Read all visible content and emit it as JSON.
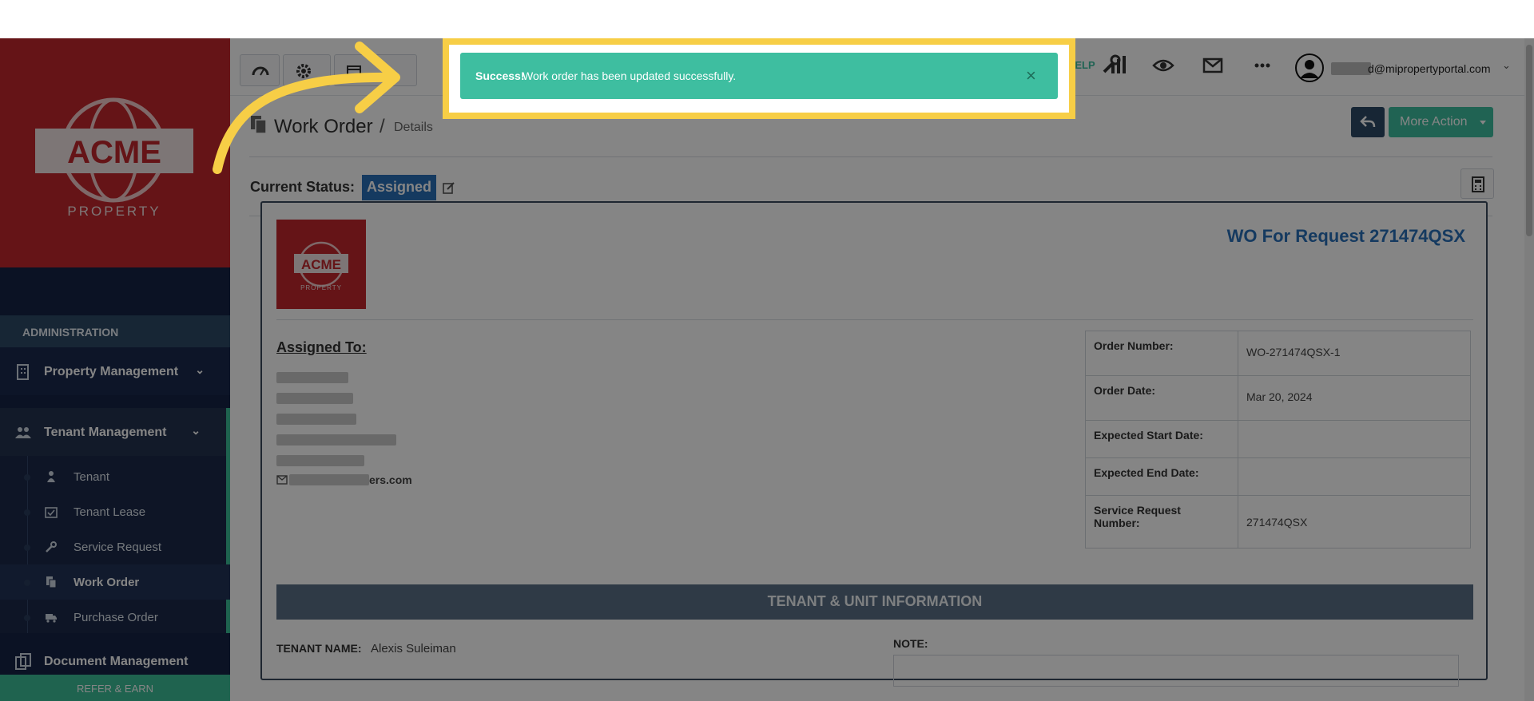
{
  "sidebar": {
    "logo_text": "ACME",
    "logo_sub": "PROPERTY",
    "section_header": "ADMINISTRATION",
    "nav": [
      {
        "label": "Property Management",
        "icon": "building-icon"
      },
      {
        "label": "Tenant Management",
        "icon": "users-icon"
      }
    ],
    "subnav": [
      {
        "label": "Tenant",
        "icon": "user-icon"
      },
      {
        "label": "Tenant Lease",
        "icon": "calendar-check-icon"
      },
      {
        "label": "Service Request",
        "icon": "wrench-icon"
      },
      {
        "label": "Work Order",
        "icon": "copy-icon"
      },
      {
        "label": "Purchase Order",
        "icon": "truck-icon"
      }
    ],
    "doc_mgmt": "Document Management",
    "refer": "REFER & EARN"
  },
  "topbar": {
    "help": "HELP",
    "user_email": "d@mipropertyportal.com"
  },
  "page": {
    "title": "Work Order",
    "breadcrumb_sep": "/",
    "breadcrumb": "Details",
    "more_action": "More Action",
    "status_label": "Current Status:",
    "status_value": "Assigned"
  },
  "wo": {
    "title": "WO For Request 271474QSX",
    "assigned_to_label": "Assigned To:",
    "assigned_email": "ers.com",
    "info": [
      {
        "key": "Order Number:",
        "value": "WO-271474QSX-1"
      },
      {
        "key": "Order Date:",
        "value": "Mar 20, 2024"
      },
      {
        "key": "Expected Start Date:",
        "value": ""
      },
      {
        "key": "Expected End Date:",
        "value": ""
      },
      {
        "key": "Service Request Number:",
        "value": "271474QSX"
      }
    ],
    "section_header": "TENANT & UNIT INFORMATION",
    "tenant_name_label": "TENANT NAME:",
    "tenant_name": "Alexis Suleiman",
    "note_label": "NOTE:"
  },
  "toast": {
    "strong": "Success!",
    "message": "Work order has been updated successfully.",
    "close": "×"
  },
  "colors": {
    "brand_red": "#c1272d",
    "sidebar_navy": "#162446",
    "accent_green": "#3ebea0",
    "highlight_yellow": "#f7ce46",
    "status_blue": "#2a6fb8",
    "title_blue": "#2a6fb8"
  }
}
